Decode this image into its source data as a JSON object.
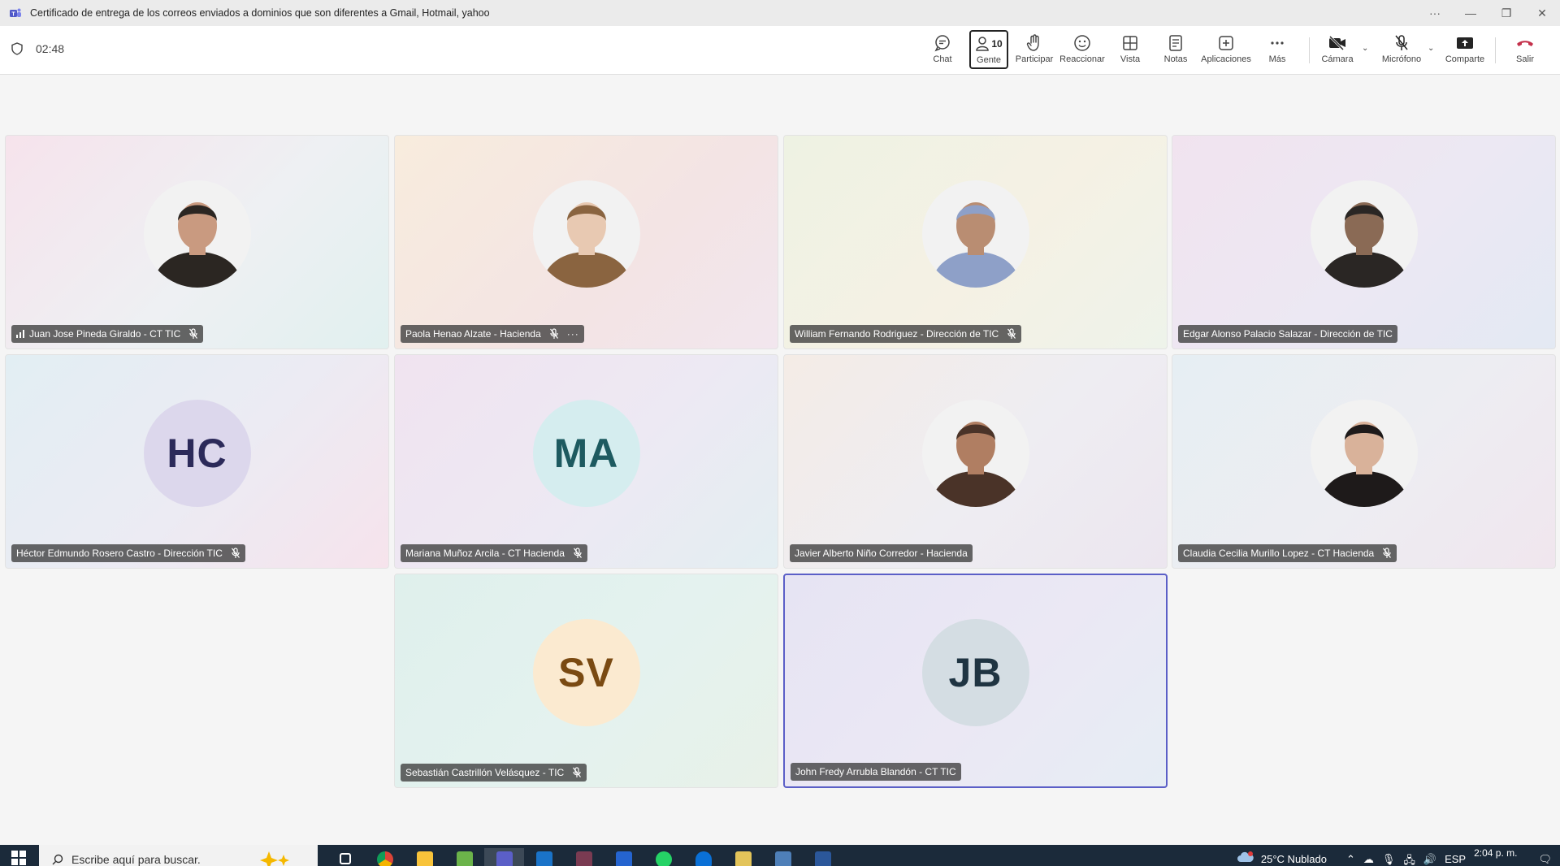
{
  "window": {
    "title": "Certificado de entrega de los correos enviados a dominios que son diferentes a Gmail, Hotmail, yahoo"
  },
  "meeting": {
    "elapsed": "02:48",
    "toolbar": {
      "chat": "Chat",
      "people": "Gente",
      "people_count": "10",
      "raise": "Participar",
      "react": "Reaccionar",
      "view": "Vista",
      "notes": "Notas",
      "apps": "Aplicaciones",
      "more": "Más",
      "camera": "Cámara",
      "mic": "Micrófono",
      "share": "Comparte",
      "leave": "Salir"
    }
  },
  "participants": [
    {
      "name": "Juan Jose Pineda Giraldo - CT TIC",
      "muted": true,
      "avatar": "photo",
      "photo_colors": [
        "#2b2622",
        "#c99a80"
      ],
      "signal": true
    },
    {
      "name": "Paola Henao Alzate - Hacienda",
      "muted": true,
      "avatar": "photo",
      "photo_colors": [
        "#8a6440",
        "#e8c9b2"
      ],
      "more": true
    },
    {
      "name": "William Fernando Rodriguez - Dirección de TIC",
      "muted": true,
      "avatar": "photo",
      "photo_colors": [
        "#8ea0c8",
        "#b98d72"
      ]
    },
    {
      "name": "Edgar Alonso Palacio Salazar - Dirección de TIC",
      "muted": false,
      "avatar": "photo",
      "photo_colors": [
        "#2a2624",
        "#8a6a55"
      ]
    },
    {
      "name": "Héctor Edmundo Rosero Castro - Dirección TIC",
      "muted": true,
      "avatar": "initials",
      "initials": "HC",
      "avatar_bg": "#dcd7ec",
      "avatar_fg": "#2c2a5a"
    },
    {
      "name": "Mariana Muñoz Arcila - CT Hacienda",
      "muted": true,
      "avatar": "initials",
      "initials": "MA",
      "avatar_bg": "#d5edef",
      "avatar_fg": "#1d5a60"
    },
    {
      "name": "Javier Alberto Niño Corredor - Hacienda",
      "muted": false,
      "avatar": "photo",
      "photo_colors": [
        "#4a3328",
        "#b07e62"
      ]
    },
    {
      "name": "Claudia Cecilia Murillo Lopez - CT Hacienda",
      "muted": true,
      "avatar": "photo",
      "photo_colors": [
        "#1e1a1a",
        "#d9b29a"
      ]
    },
    {
      "name": "Sebastián Castrillón Velásquez - TIC",
      "muted": true,
      "avatar": "initials",
      "initials": "SV",
      "avatar_bg": "#fbead0",
      "avatar_fg": "#7a4a12"
    },
    {
      "name": "John Fredy Arrubla Blandón - CT TIC",
      "muted": false,
      "avatar": "initials",
      "initials": "JB",
      "avatar_bg": "#d4dde3",
      "avatar_fg": "#1f3442",
      "selected": true
    }
  ],
  "taskbar": {
    "search_placeholder": "Escribe aquí para buscar.",
    "weather": "25°C  Nublado",
    "language": "ESP",
    "time": "2:04 p. m."
  },
  "colors": {
    "accent": "#5b5fc7",
    "leave": "#c4314b"
  }
}
